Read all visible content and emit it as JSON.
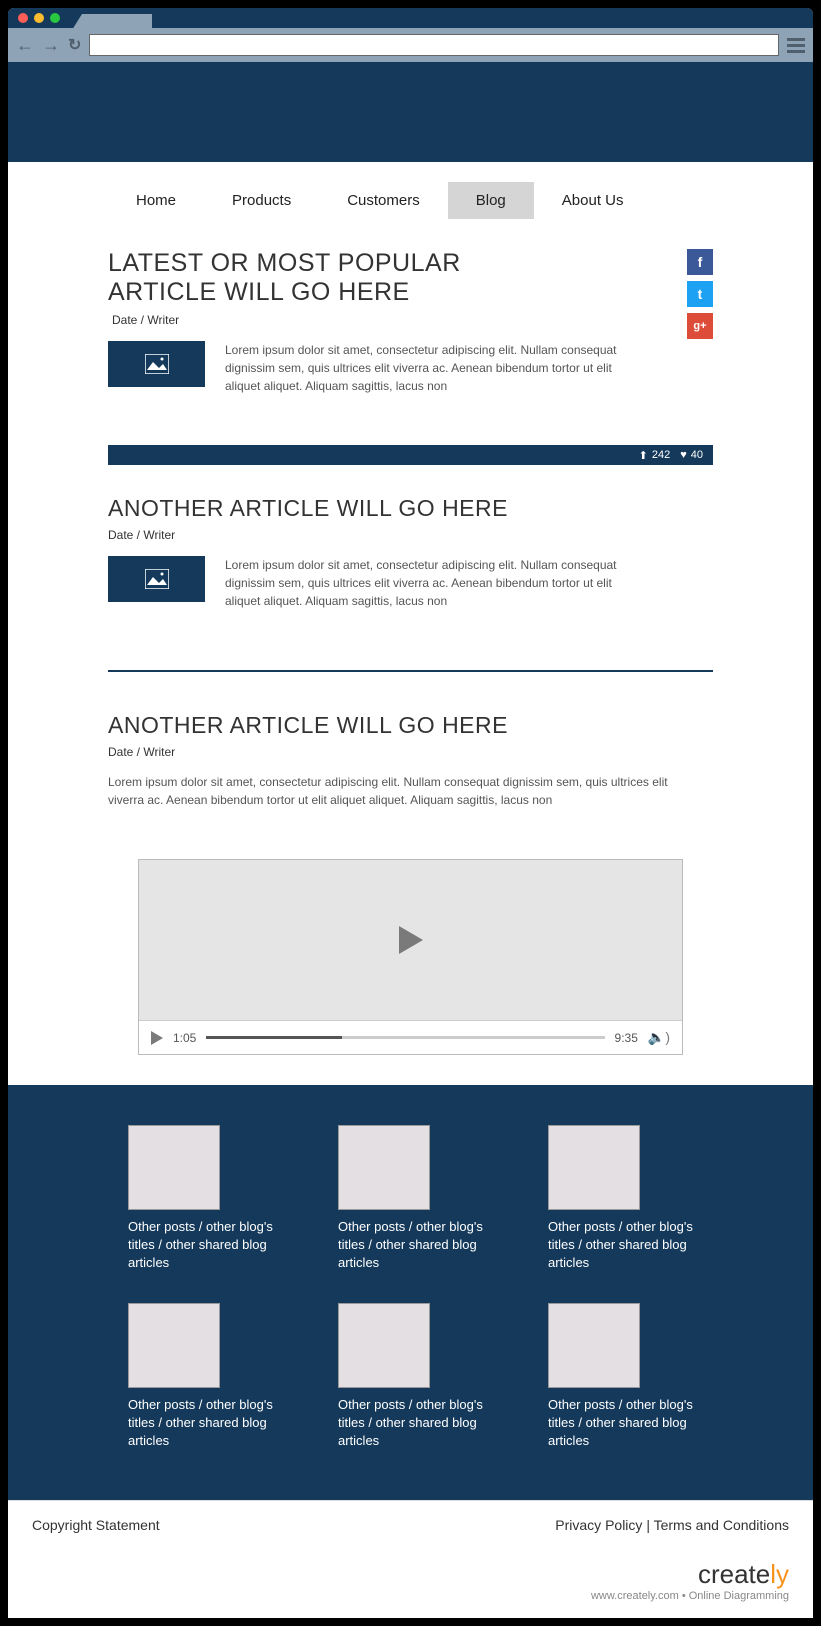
{
  "nav": {
    "items": [
      "Home",
      "Products",
      "Customers",
      "Blog",
      "About Us"
    ],
    "activeIndex": 3
  },
  "article1": {
    "title": "LATEST OR MOST POPULAR ARTICLE WILL GO HERE",
    "meta": "Date / Writer",
    "excerpt": "Lorem ipsum dolor sit amet, consectetur adipiscing elit. Nullam consequat dignissim sem, quis ultrices elit viverra ac. Aenean bibendum tortor ut elit aliquet aliquet. Aliquam sagittis, lacus non"
  },
  "stats": {
    "uploads": "242",
    "likes": "40"
  },
  "article2": {
    "title": "ANOTHER ARTICLE WILL GO HERE",
    "meta": "Date / Writer",
    "excerpt": "Lorem ipsum dolor sit amet, consectetur adipiscing elit. Nullam consequat dignissim sem, quis ultrices elit viverra ac. Aenean bibendum tortor ut elit aliquet aliquet. Aliquam sagittis, lacus non"
  },
  "article3": {
    "title": "ANOTHER ARTICLE WILL GO HERE",
    "meta": "Date / Writer",
    "excerpt": "Lorem ipsum dolor sit amet, consectetur adipiscing elit. Nullam consequat dignissim sem, quis ultrices elit viverra ac. Aenean bibendum tortor ut elit aliquet aliquet. Aliquam sagittis, lacus non"
  },
  "video": {
    "current": "1:05",
    "total": "9:35"
  },
  "related": {
    "cards": [
      "Other posts / other blog's titles / other shared blog articles",
      "Other posts / other blog's titles / other shared blog articles",
      "Other posts / other blog's titles / other shared blog articles",
      "Other posts / other blog's titles / other shared blog articles",
      "Other posts / other blog's titles / other shared blog articles",
      "Other posts / other blog's titles / other shared blog articles"
    ]
  },
  "footer": {
    "copyright": "Copyright Statement",
    "privacy": "Privacy Policy",
    "terms": "Terms and Conditions"
  },
  "branding": {
    "tagline": "www.creately.com • Online Diagramming"
  },
  "social": {
    "fb": "f",
    "tw": "t",
    "gp": "g+"
  }
}
